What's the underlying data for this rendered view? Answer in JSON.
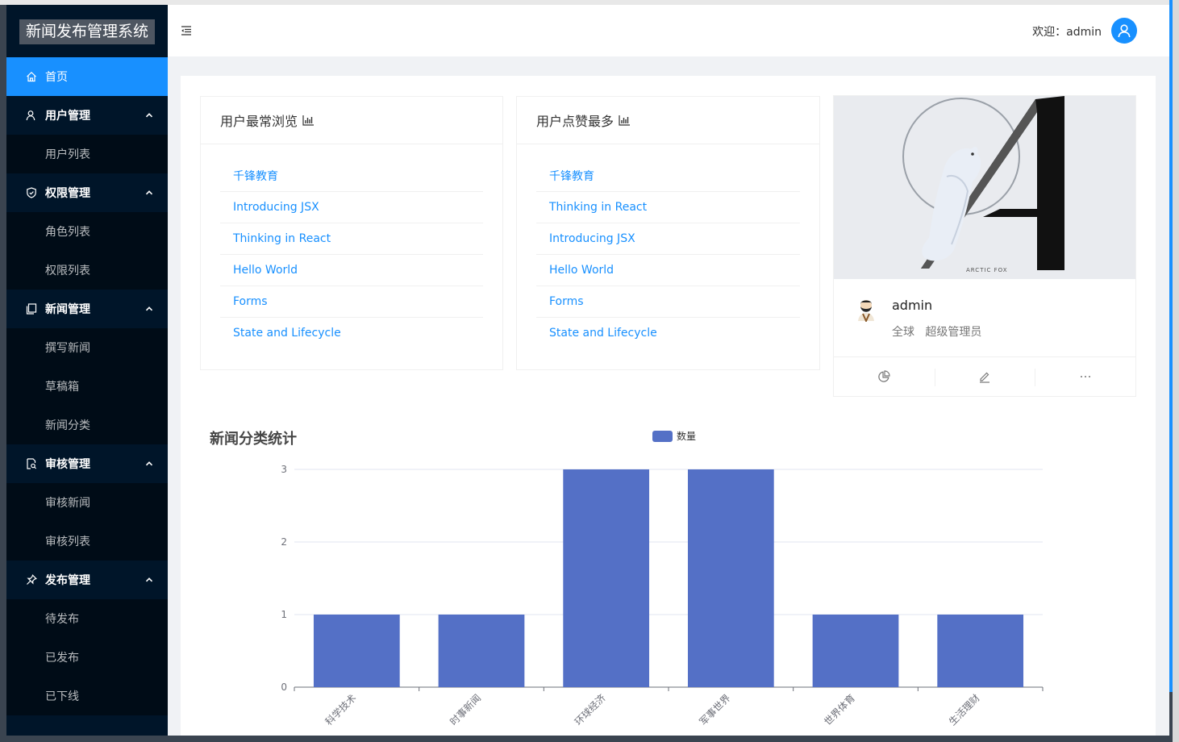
{
  "app": {
    "title": "新闻发布管理系统"
  },
  "menu": {
    "home": "首页",
    "user_group": "用户管理",
    "user_list": "用户列表",
    "right_group": "权限管理",
    "role_list": "角色列表",
    "right_list": "权限列表",
    "news_group": "新闻管理",
    "news_add": "撰写新闻",
    "news_draft": "草稿箱",
    "news_category": "新闻分类",
    "audit_group": "审核管理",
    "audit_news": "审核新闻",
    "audit_list": "审核列表",
    "publish_group": "发布管理",
    "unpublished": "待发布",
    "published": "已发布",
    "sunset": "已下线"
  },
  "header": {
    "welcome": "欢迎：admin"
  },
  "most_viewed": {
    "title": "用户最常浏览",
    "items": [
      "千锋教育",
      "Introducing JSX",
      "Thinking in React",
      "Hello World",
      "Forms",
      "State and Lifecycle"
    ]
  },
  "most_liked": {
    "title": "用户点赞最多",
    "items": [
      "千锋教育",
      "Thinking in React",
      "Introducing JSX",
      "Hello World",
      "Forms",
      "State and Lifecycle"
    ]
  },
  "profile": {
    "cover_text": "ARCTIC FOX",
    "name": "admin",
    "region": "全球",
    "role": "超级管理员"
  },
  "colors": {
    "primary": "#1890ff",
    "sider": "#001529",
    "bar": "#5470c6"
  },
  "chart_data": {
    "type": "bar",
    "title": "新闻分类统计",
    "legend": "数量",
    "categories": [
      "科学技术",
      "时事新闻",
      "环球经济",
      "军事世界",
      "世界体育",
      "生活理财"
    ],
    "series": [
      {
        "name": "数量",
        "values": [
          1,
          1,
          3,
          3,
          1,
          1
        ]
      }
    ],
    "ylim": [
      0,
      3
    ],
    "yticks": [
      0,
      1,
      2,
      3
    ]
  }
}
